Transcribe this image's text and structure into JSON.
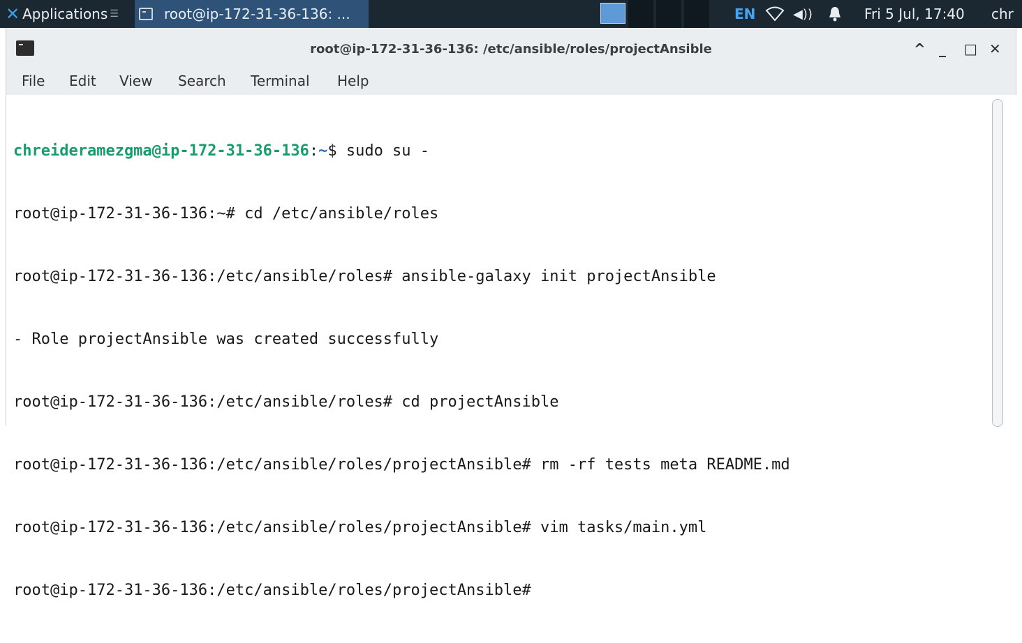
{
  "panel": {
    "applications_label": "Applications",
    "task_label": "root@ip-172-31-36-136: ...",
    "language": "EN",
    "clock": "Fri  5 Jul, 17:40",
    "user": "chr"
  },
  "window": {
    "title": "root@ip-172-31-36-136: /etc/ansible/roles/projectAnsible",
    "controls": {
      "up": "^",
      "minimize": "_",
      "maximize": "□",
      "close": "✕"
    }
  },
  "menu": {
    "file": "File",
    "edit": "Edit",
    "view": "View",
    "search": "Search",
    "terminal": "Terminal",
    "help": "Help"
  },
  "terminal": {
    "first_prompt_user": "chreideramezgma@ip-172-31-36-136",
    "first_prompt_colon": ":",
    "first_prompt_path": "~",
    "first_prompt_rest": "$ sudo su -",
    "lines": [
      "root@ip-172-31-36-136:~# cd /etc/ansible/roles",
      "root@ip-172-31-36-136:/etc/ansible/roles# ansible-galaxy init projectAnsible",
      "- Role projectAnsible was created successfully",
      "root@ip-172-31-36-136:/etc/ansible/roles# cd projectAnsible",
      "root@ip-172-31-36-136:/etc/ansible/roles/projectAnsible# rm -rf tests meta README.md",
      "root@ip-172-31-36-136:/etc/ansible/roles/projectAnsible# vim tasks/main.yml",
      "root@ip-172-31-36-136:/etc/ansible/roles/projectAnsible#"
    ]
  }
}
